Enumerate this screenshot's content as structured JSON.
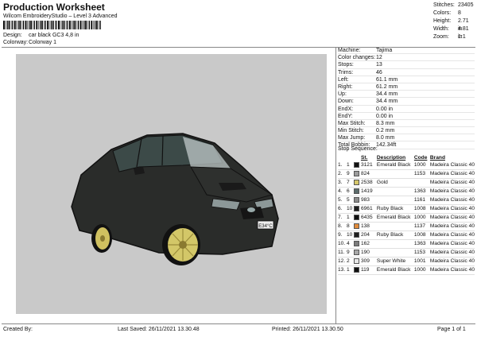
{
  "header": {
    "title": "Production Worksheet",
    "subtitle": "Wilcom EmbroideryStudio – Level 3 Advanced",
    "design_label": "Design:",
    "design_value": "car black GC3 4,8 in",
    "colorway_label": "Colorway:",
    "colorway_value": "Colorway 1"
  },
  "stats": [
    {
      "label": "Stitches:",
      "value": "23405"
    },
    {
      "label": "Colors:",
      "value": "8"
    },
    {
      "label": "Height:",
      "value": "2.71 in"
    },
    {
      "label": "Width:",
      "value": "4.81 in"
    },
    {
      "label": "Zoom:",
      "value": "1:1"
    }
  ],
  "machine": [
    {
      "label": "Machine:",
      "value": "Tajima"
    },
    {
      "label": "Color changes:",
      "value": "12"
    },
    {
      "label": "Stops:",
      "value": "13"
    },
    {
      "label": "Trims:",
      "value": "46"
    },
    {
      "label": "Left:",
      "value": "61.1 mm"
    },
    {
      "label": "Right:",
      "value": "61.2 mm"
    },
    {
      "label": "Up:",
      "value": "34.4 mm"
    },
    {
      "label": "Down:",
      "value": "34.4 mm"
    },
    {
      "label": "EndX:",
      "value": "0.00 in"
    },
    {
      "label": "EndY:",
      "value": "0.00 in"
    },
    {
      "label": "Max Stitch:",
      "value": "8.3 mm"
    },
    {
      "label": "Min Stitch:",
      "value": "0.2 mm"
    },
    {
      "label": "Max Jump:",
      "value": "8.0 mm"
    },
    {
      "label": "Total Bobbin:",
      "value": "142.34ft"
    }
  ],
  "sequence": {
    "title": "Stop Sequence:",
    "headers": [
      "",
      "",
      "",
      "St.",
      "Description",
      "Code",
      "Brand"
    ],
    "rows": [
      {
        "num": "1.",
        "n": "1",
        "color": "#111111",
        "st": "3121",
        "desc": "Emerald Black",
        "code": "1000",
        "brand": "Madeira Classic 40"
      },
      {
        "num": "2.",
        "n": "9",
        "color": "#9c9c9c",
        "st": "824",
        "desc": "",
        "code": "1153",
        "brand": "Madeira Classic 40"
      },
      {
        "num": "3.",
        "n": "7",
        "color": "#d6c76a",
        "st": "2538",
        "desc": "Gold",
        "code": "",
        "brand": "Madeira Classic 40"
      },
      {
        "num": "4.",
        "n": "6",
        "color": "#5c6c6c",
        "st": "1419",
        "desc": "",
        "code": "1363",
        "brand": "Madeira Classic 40"
      },
      {
        "num": "5.",
        "n": "5",
        "color": "#8c8c8c",
        "st": "983",
        "desc": "",
        "code": "1161",
        "brand": "Madeira Classic 40"
      },
      {
        "num": "6.",
        "n": "10",
        "color": "#1e1e1e",
        "st": "6961",
        "desc": "Ruby Black",
        "code": "1008",
        "brand": "Madeira Classic 40"
      },
      {
        "num": "7.",
        "n": "1",
        "color": "#111111",
        "st": "6435",
        "desc": "Emerald Black",
        "code": "1000",
        "brand": "Madeira Classic 40"
      },
      {
        "num": "8.",
        "n": "8",
        "color": "#e08a3a",
        "st": "138",
        "desc": "",
        "code": "1137",
        "brand": "Madeira Classic 40"
      },
      {
        "num": "9.",
        "n": "10",
        "color": "#1e1e1e",
        "st": "204",
        "desc": "Ruby Black",
        "code": "1008",
        "brand": "Madeira Classic 40"
      },
      {
        "num": "10.",
        "n": "4",
        "color": "#7c7c7c",
        "st": "162",
        "desc": "",
        "code": "1363",
        "brand": "Madeira Classic 40"
      },
      {
        "num": "11.",
        "n": "9",
        "color": "#a8a8a8",
        "st": "190",
        "desc": "",
        "code": "1153",
        "brand": "Madeira Classic 40"
      },
      {
        "num": "12.",
        "n": "2",
        "color": "#e8e8e8",
        "st": "309",
        "desc": "Super White",
        "code": "1001",
        "brand": "Madeira Classic 40"
      },
      {
        "num": "13.",
        "n": "1",
        "color": "#111111",
        "st": "119",
        "desc": "Emerald Black",
        "code": "1000",
        "brand": "Madeira Classic 40"
      }
    ]
  },
  "plate": "E34°C",
  "footer": {
    "created": "Created By:",
    "saved": "Last Saved: 26/11/2021 13.30.48",
    "printed": "Printed: 26/11/2021 13.30.50",
    "page": "Page 1 of 1"
  }
}
